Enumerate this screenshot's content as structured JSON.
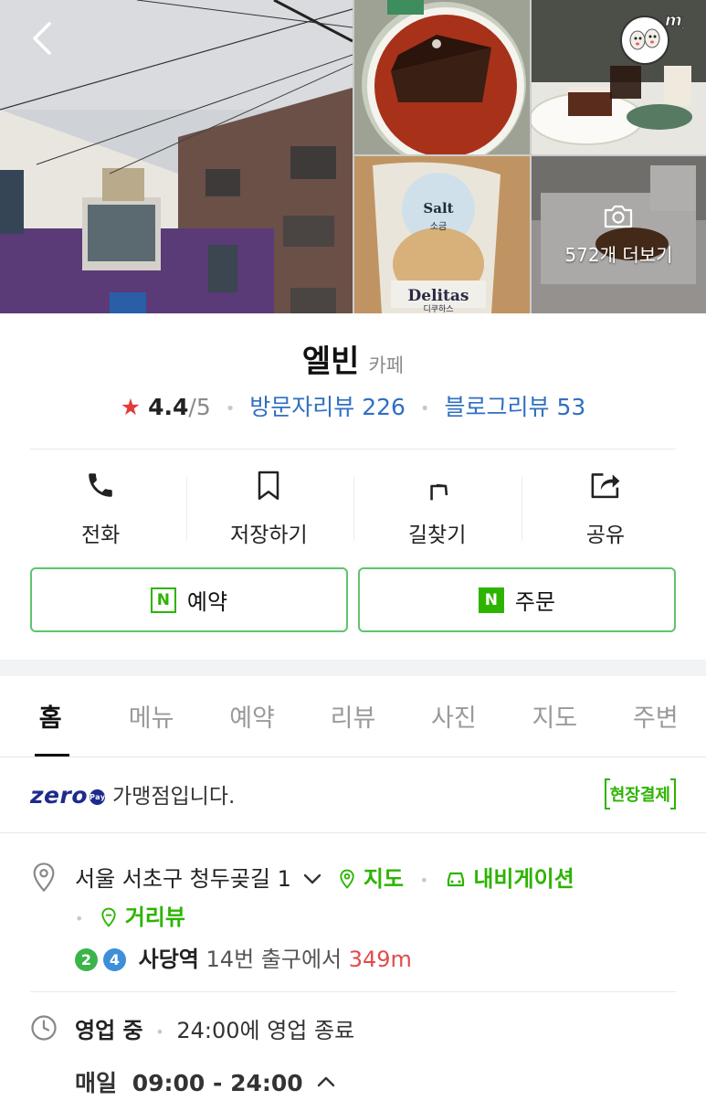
{
  "photos": {
    "more_label": "572개 더보기",
    "badge_text": "my",
    "bag_text_1": "Salt",
    "bag_text_2": "소금",
    "bag_brand": "Delitas",
    "bag_brand_kr": "디쿠하스"
  },
  "place": {
    "name": "엘빈",
    "category": "카페",
    "rating": "4.4",
    "rating_max": "/5",
    "visitor_review_label": "방문자리뷰",
    "visitor_review_count": "226",
    "blog_review_label": "블로그리뷰",
    "blog_review_count": "53"
  },
  "actions": [
    {
      "label": "전화",
      "icon": "phone-icon"
    },
    {
      "label": "저장하기",
      "icon": "bookmark-icon"
    },
    {
      "label": "길찾기",
      "icon": "directions-icon"
    },
    {
      "label": "공유",
      "icon": "share-icon"
    }
  ],
  "naver_buttons": {
    "reserve_label": "예약",
    "order_label": "주문",
    "badge": "N"
  },
  "tabs": [
    {
      "label": "홈",
      "active": true
    },
    {
      "label": "메뉴"
    },
    {
      "label": "예약"
    },
    {
      "label": "리뷰"
    },
    {
      "label": "사진"
    },
    {
      "label": "지도"
    },
    {
      "label": "주변"
    }
  ],
  "zero_pay": {
    "logo": "zero",
    "logo_pay": "Pay",
    "text": "가맹점입니다.",
    "onsite_label": "현장결제"
  },
  "address": {
    "text": "서울 서초구 청두곶길 1",
    "map_label": "지도",
    "navi_label": "내비게이션",
    "street_view_label": "거리뷰"
  },
  "subway": {
    "lines": [
      {
        "num": "2",
        "color": "#3cb44a"
      },
      {
        "num": "4",
        "color": "#3c8fd8"
      }
    ],
    "station": "사당역",
    "exit_text": "14번 출구에서",
    "distance": "349m"
  },
  "hours": {
    "status": "영업 중",
    "close_text": "24:00에 영업 종료",
    "day_label": "매일",
    "range": "09:00 - 24:00"
  },
  "colors": {
    "naver_green": "#2db400",
    "link_blue": "#2f6fc2",
    "star_red": "#e33b3b",
    "zero_navy": "#1e2b8c"
  }
}
